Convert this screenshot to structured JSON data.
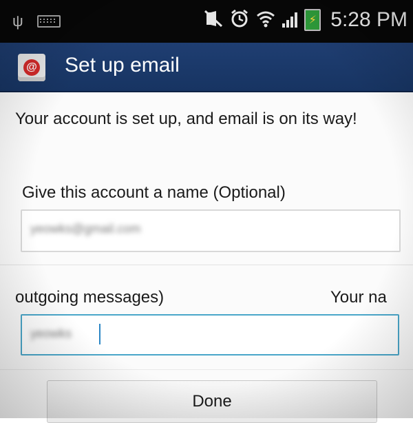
{
  "status_bar": {
    "time": "5:28 PM",
    "icons": [
      "usb-icon",
      "keyboard-icon",
      "mute-icon",
      "alarm-icon",
      "wifi-icon",
      "signal-icon",
      "battery-charging-icon"
    ],
    "colors": {
      "background": "#070707",
      "battery": "#2e9b3a"
    }
  },
  "app_bar": {
    "title": "Set up email",
    "icon": "email-app-icon",
    "colors": {
      "background": "#1f3e72"
    }
  },
  "main": {
    "message": "Your account is set up, and email is on its way!",
    "account_name_label": "Give this account a name (Optional)",
    "account_name_value": "yeowks@gmail.com",
    "outgoing_label": "outgoing messages)",
    "your_name_label": "Your na",
    "your_name_value": "yeowks",
    "done_label": "Done"
  },
  "colors": {
    "focus_border": "#49a6c9"
  }
}
